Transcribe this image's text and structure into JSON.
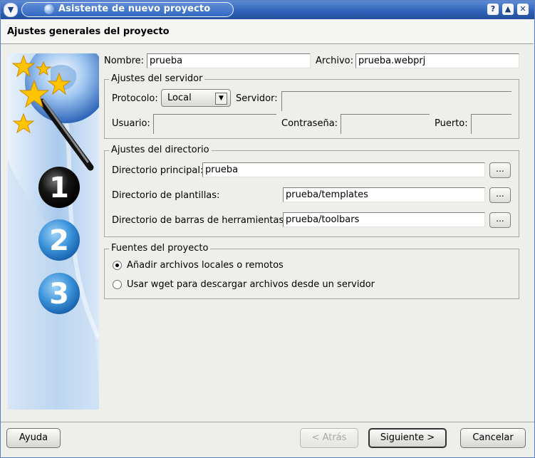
{
  "window": {
    "title": "Asistente de nuevo proyecto",
    "menu_icon": "chevron-down-icon",
    "help_label": "?",
    "shade_label": "▲",
    "close_label": "✕"
  },
  "page_title": "Ajustes generales del proyecto",
  "side_panel": {
    "steps": [
      "1",
      "2",
      "3"
    ],
    "active_step": 1
  },
  "project": {
    "name_label": "Nombre:",
    "name_value": "prueba",
    "file_label": "Archivo:",
    "file_value": "prueba.webprj"
  },
  "server": {
    "title": "Ajustes del servidor",
    "protocol_label": "Protocolo:",
    "protocol_value": "Local",
    "server_label": "Servidor:",
    "user_label": "Usuario:",
    "password_label": "Contraseña:",
    "port_label": "Puerto:"
  },
  "directories": {
    "title": "Ajustes del directorio",
    "main_label": "Directorio principal:",
    "main_value": "prueba",
    "templates_label": "Directorio de plantillas:",
    "templates_value": "prueba/templates",
    "toolbars_label": "Directorio de barras de herramientas:",
    "toolbars_value": "prueba/toolbars",
    "browse_label": "..."
  },
  "sources": {
    "title": "Fuentes del proyecto",
    "option_local": "Añadir archivos locales o remotos",
    "option_wget": "Usar wget para descargar archivos desde un servidor",
    "selected": "option_local"
  },
  "buttons": {
    "help": "Ayuda",
    "back": "< Atrás",
    "next": "Siguiente >",
    "cancel": "Cancelar"
  }
}
